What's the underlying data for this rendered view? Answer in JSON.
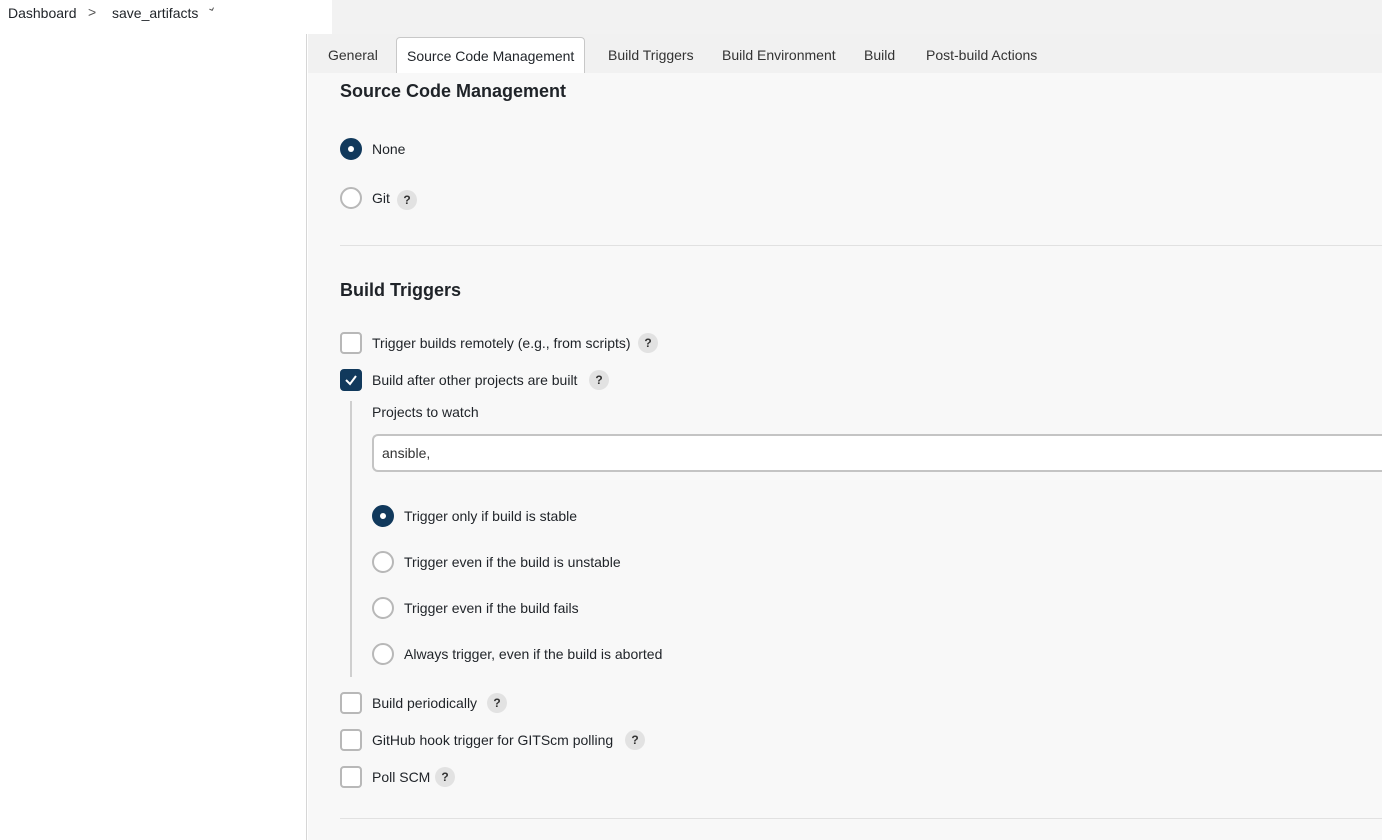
{
  "breadcrumb": {
    "items": [
      "Dashboard",
      "save_artifacts"
    ],
    "separator": ">",
    "caret": "⌄"
  },
  "tabs": [
    {
      "label": "General",
      "active": false
    },
    {
      "label": "Source Code Management",
      "active": true
    },
    {
      "label": "Build Triggers",
      "active": false
    },
    {
      "label": "Build Environment",
      "active": false
    },
    {
      "label": "Build",
      "active": false
    },
    {
      "label": "Post-build Actions",
      "active": false
    }
  ],
  "scm": {
    "title": "Source Code Management",
    "options": [
      {
        "label": "None",
        "selected": true,
        "help": false
      },
      {
        "label": "Git",
        "selected": false,
        "help": true
      }
    ]
  },
  "triggers": {
    "title": "Build Triggers",
    "trigger_remote": {
      "label": "Trigger builds remotely (e.g., from scripts)",
      "checked": false
    },
    "build_after": {
      "label": "Build after other projects are built",
      "checked": true
    },
    "projects_to_watch": {
      "label": "Projects to watch",
      "value": "ansible,"
    },
    "conditions": [
      {
        "label": "Trigger only if build is stable",
        "selected": true
      },
      {
        "label": "Trigger even if the build is unstable",
        "selected": false
      },
      {
        "label": "Trigger even if the build fails",
        "selected": false
      },
      {
        "label": "Always trigger, even if the build is aborted",
        "selected": false
      }
    ],
    "build_periodically": {
      "label": "Build periodically",
      "checked": false
    },
    "github_hook": {
      "label": "GitHub hook trigger for GITScm polling",
      "checked": false
    },
    "poll_scm": {
      "label": "Poll SCM",
      "checked": false
    }
  },
  "help_glyph": "?",
  "colors": {
    "accent": "#11395c",
    "tabbar": "#f1f1f1",
    "panel": "#f8f8f8"
  }
}
